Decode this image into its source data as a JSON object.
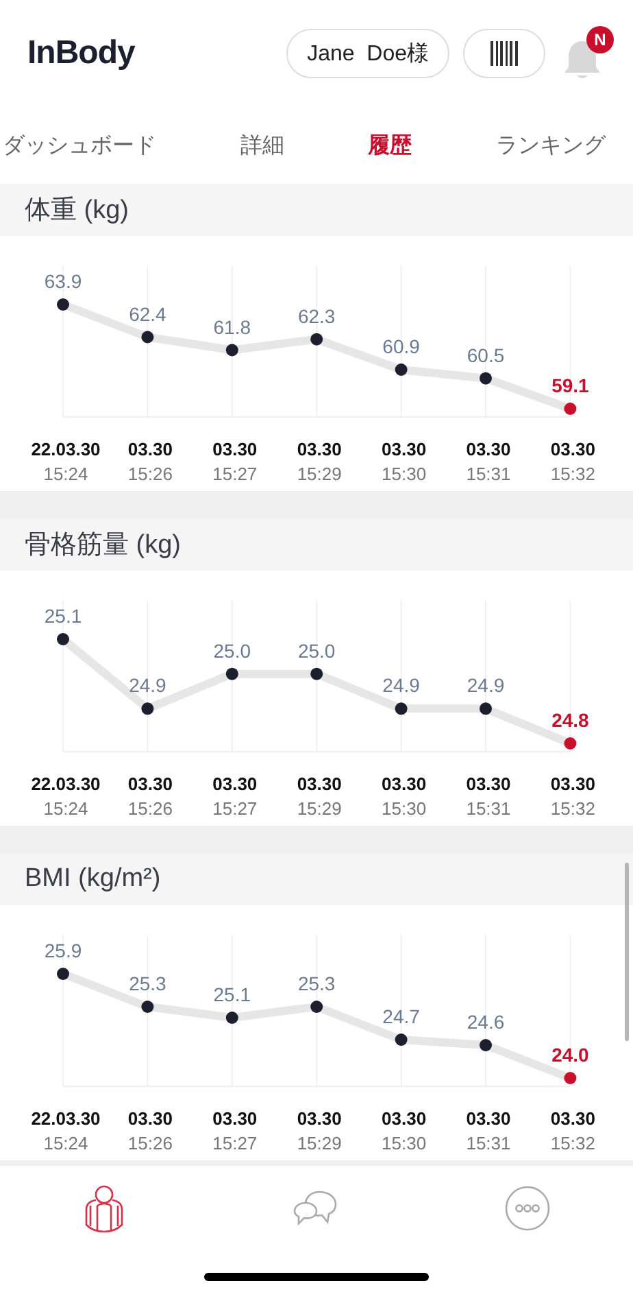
{
  "header": {
    "logo": "InBody",
    "user_button": "Jane  Doe様",
    "notification_badge": "N"
  },
  "tabs": [
    {
      "label": "ダッシュボード",
      "selected": false
    },
    {
      "label": "詳細",
      "selected": false
    },
    {
      "label": "履歴",
      "selected": true
    },
    {
      "label": "ランキング",
      "selected": false
    }
  ],
  "sections": [
    {
      "title": "体重 (kg)",
      "chart_data": {
        "type": "line",
        "grid": true,
        "categories": [
          "22.03.30\n15:24",
          "03.30\n15:26",
          "03.30\n15:27",
          "03.30\n15:29",
          "03.30\n15:30",
          "03.30\n15:31",
          "03.30\n15:32"
        ],
        "series": [
          {
            "color": "#1c1f2e",
            "marker": true,
            "values": [
              63.9,
              62.4,
              61.8,
              62.3,
              60.9,
              60.5,
              59.1
            ],
            "value_labels": [
              "63.9",
              "62.4",
              "61.8",
              "62.3",
              "60.9",
              "60.5",
              "59.1"
            ]
          }
        ]
      }
    },
    {
      "title": "骨格筋量 (kg)",
      "chart_data": {
        "type": "line",
        "grid": true,
        "categories": [
          "22.03.30\n15:24",
          "03.30\n15:26",
          "03.30\n15:27",
          "03.30\n15:29",
          "03.30\n15:30",
          "03.30\n15:31",
          "03.30\n15:32"
        ],
        "series": [
          {
            "color": "#1c1f2e",
            "marker": true,
            "values": [
              25.1,
              24.9,
              25.0,
              25.0,
              24.9,
              24.9,
              24.8
            ],
            "value_labels": [
              "25.1",
              "24.9",
              "25.0",
              "25.0",
              "24.9",
              "24.9",
              "24.8"
            ]
          }
        ]
      }
    },
    {
      "title": "BMI (kg/m²)",
      "chart_data": {
        "type": "line",
        "grid": true,
        "categories": [
          "22.03.30\n15:24",
          "03.30\n15:26",
          "03.30\n15:27",
          "03.30\n15:29",
          "03.30\n15:30",
          "03.30\n15:31",
          "03.30\n15:32"
        ],
        "series": [
          {
            "color": "#1c1f2e",
            "marker": true,
            "values": [
              25.9,
              25.3,
              25.1,
              25.3,
              24.7,
              24.6,
              24.0
            ],
            "value_labels": [
              "25.9",
              "25.3",
              "25.1",
              "25.3",
              "24.7",
              "24.6",
              "24.0"
            ]
          }
        ]
      }
    }
  ],
  "bottom_nav": [
    {
      "kind": "body",
      "selected": true
    },
    {
      "kind": "chat",
      "selected": false
    },
    {
      "kind": "more",
      "selected": false
    }
  ]
}
